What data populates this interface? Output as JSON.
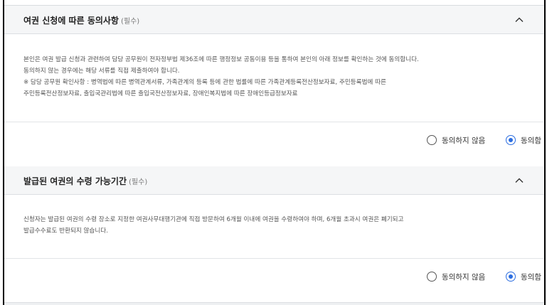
{
  "sections": [
    {
      "title": "여권 신청에 따른 동의사항",
      "required": "(필수)",
      "collapse_icon": "chevron-up-icon",
      "body_lines": [
        "본인은 여권 발급 신청과 관련하여 담당 공무원이 전자정부법 제36조에 따른 행정정보 공동이용 등을 통하여 본인의 아래 정보를 확인하는 것에 동의합니다.",
        "동의하지 않는 경우에는 해당 서류를 직접 제출하여야 합니다.",
        "※ 담당 공무원 확인사항 : 병역법에 따른 병역관계서류, 가족관계의 등록 등에 관한 법률에 따른 가족관계등록전산정보자료, 주민등록법에 따른",
        "주민등록전산정보자료, 출입국관리법에 따른 출입국전산정보자료, 장애인복지법에 따른 장애인등급정보자료"
      ],
      "options": [
        {
          "label": "동의하지 않음",
          "checked": false
        },
        {
          "label": "동의함",
          "checked": true
        }
      ]
    },
    {
      "title": "발급된 여권의 수령 가능기간",
      "required": "(필수)",
      "collapse_icon": "chevron-up-icon",
      "body_lines": [
        "신청자는 발급된 여권의 수령 장소로 지정한 여권사무대행기관에 직접 방문하여 6개월 이내에 여권을 수령하여야 하며, 6개월 초과시 여권은 폐기되고",
        "발급수수료도 반환되지 않습니다."
      ],
      "options": [
        {
          "label": "동의하지 않음",
          "checked": false
        },
        {
          "label": "동의함",
          "checked": true
        }
      ]
    }
  ],
  "colors": {
    "accent": "#2b6de0",
    "header_bg": "#f5f6f7",
    "text": "#222222",
    "muted": "#555555"
  }
}
